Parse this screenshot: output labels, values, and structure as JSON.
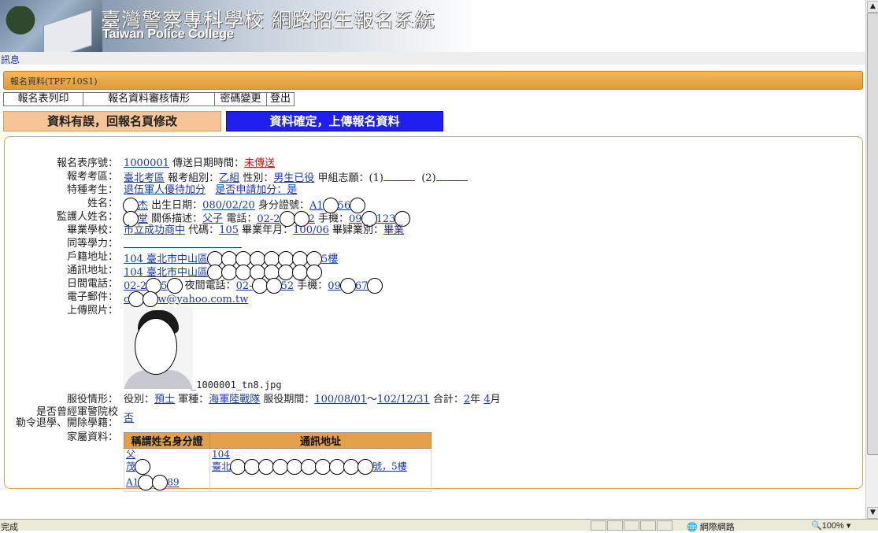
{
  "banner": {
    "title": "臺灣警察專科學校  網路招生報名系統",
    "subtitle": "Taiwan Police College"
  },
  "message_link": "訊息",
  "section_title": "報名資料(TPF710S1)",
  "menu": [
    "報名表列印",
    "報名資料審核情形",
    "密碼變更",
    "登出"
  ],
  "buttons": {
    "fix": "資料有誤，回報名頁修改",
    "upload": "資料確定，上傳報名資料"
  },
  "form": {
    "serial_label": "報名表序號：",
    "serial_value": "1000001",
    "sent_time_label": "傳送日期時間：",
    "sent_time_value": "未傳送",
    "exam_area_label": "報考考區：",
    "exam_area_value": "臺北考區",
    "group_label": "報考組別：",
    "group_value": "乙組",
    "gender_label": "性別：",
    "gender_value": "男生已役",
    "wish_label": "甲組志願：",
    "wish_1": "(1)",
    "wish_2": "(2)",
    "special_label": "特種考生：",
    "special_value": "退伍軍人優待加分",
    "special_apply": "是否申請加分：是",
    "name_label": "姓名：",
    "name_value": "杰",
    "birth_label": "出生日期：",
    "birth_value": "080/02/20",
    "id_label": "身分證號：",
    "id_value_a": "A1",
    "id_value_b": "56",
    "guardian_label": "監護人姓名：",
    "guardian_value": "堂",
    "relation_label": "關係描述：",
    "relation_value": "父子",
    "phone_label": "電話：",
    "phone_value": "02-2",
    "phone_tail": "2",
    "mobile_label": "手機：",
    "mobile_value": "09",
    "mobile_mid": "123",
    "school_label": "畢業學校：",
    "school_value": "市立成功商中",
    "code_label": "代碼：",
    "code_value": "105",
    "grad_label": "畢業年月：",
    "grad_value": "100/06",
    "grad_type_label": "畢肄業別：",
    "grad_type_value": "畢業",
    "equiv_label": "同等學力：",
    "reg_addr_label": "戶籍地址：",
    "reg_addr_zip": "104",
    "reg_addr_value": "臺北市中山區",
    "reg_addr_tail": "5樓",
    "mail_addr_label": "通訊地址：",
    "mail_addr_zip": "104",
    "mail_addr_value": "臺北市中山區",
    "day_phone_label": "日間電話：",
    "day_phone_value": "02-2",
    "day_phone_mid": "5",
    "night_phone_label": "夜間電話：",
    "night_phone_value": "02-",
    "night_phone_tail": "52",
    "mobile2_label": "手機：",
    "mobile2_value": "09",
    "mobile2_tail": "67",
    "email_label": "電子郵件：",
    "email_value": "c",
    "email_tail": "w@yahoo.com.tw",
    "photo_label": "上傳照片：",
    "photo_file": "_1000001_tn8.jpg",
    "service_label": "服役情形：",
    "service_role_label": "役別：",
    "service_role_value": "預士",
    "service_branch_label": "軍種：",
    "service_branch_value": "海軍陸戰隊",
    "service_period_label": "服役期間：",
    "service_start": "100/08/01",
    "service_sep": "～",
    "service_end": "102/12/31",
    "service_total_label": "合計：",
    "service_years": "2",
    "service_years_unit": "年",
    "service_months": "4",
    "service_months_unit": "月",
    "expel_label_1": "是否曾經軍警院校",
    "expel_label_2": "勒令退學、開除學籍：",
    "expel_value": "否",
    "family_label": "家屬資料：",
    "family_headers": [
      "稱謂姓名身分證",
      "通訊地址"
    ],
    "family_rows": [
      {
        "relation": "父",
        "name": "茂",
        "id_a": "A1",
        "id_b": "89",
        "zip": "104",
        "addr_a": "臺北",
        "addr_b": "號，5樓"
      }
    ]
  },
  "statusbar": {
    "done": "完成",
    "zone": "網際網路",
    "zoom": "100%"
  }
}
